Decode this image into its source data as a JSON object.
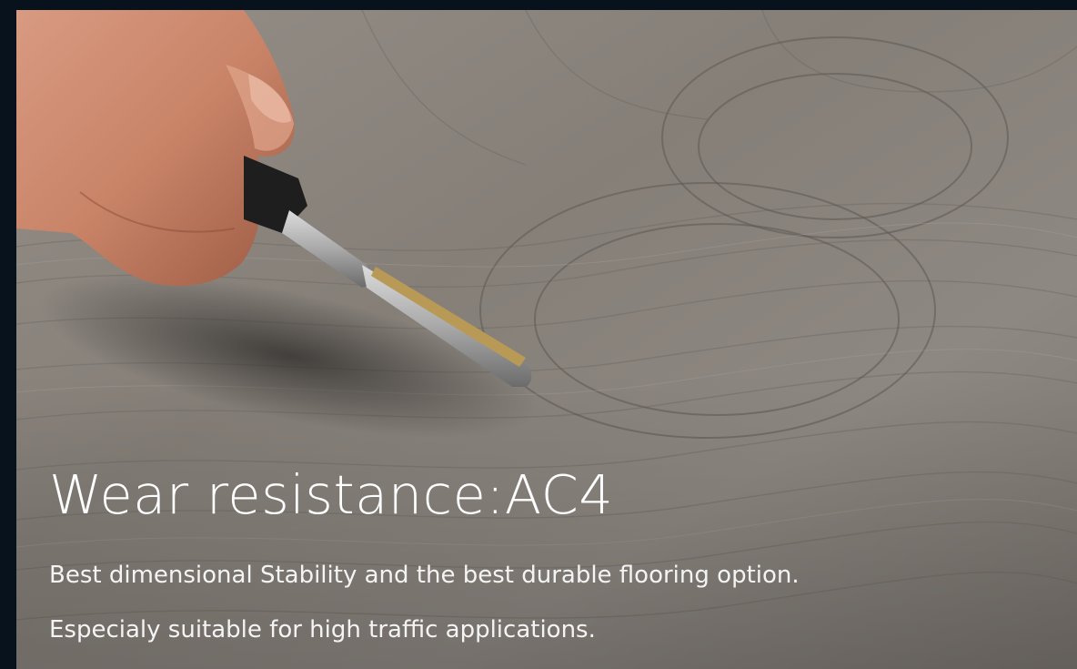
{
  "hero": {
    "title": "Wear resistance:AC4",
    "description_lines": [
      "Best dimensional Stability and the best durable flooring option.",
      "Especialy suitable for high traffic applications."
    ]
  },
  "colors": {
    "page_background": "#07121c",
    "text": "#ffffff",
    "wood_tone": "#857f78"
  },
  "image": {
    "subject": "hand-scratching-wood-floor-with-key"
  }
}
